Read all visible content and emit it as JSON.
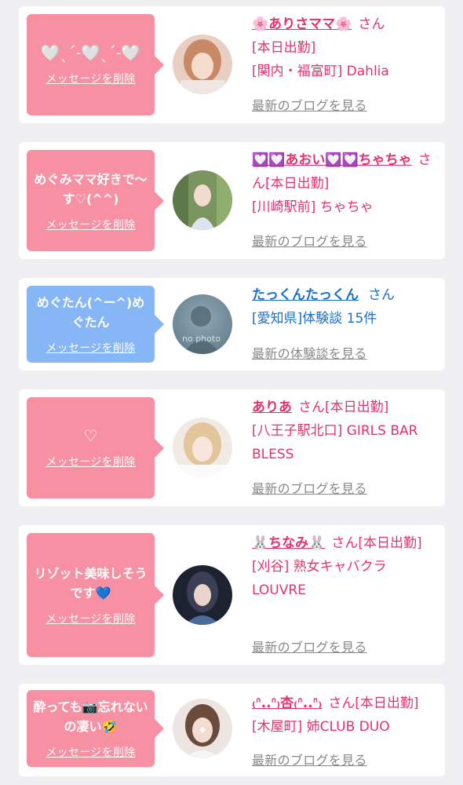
{
  "delete_label": "メッセージを削除",
  "cards": [
    {
      "message": "🤍ˎˊ˗🤍ˎˊ˗🤍",
      "name": "🌸ありさママ🌸",
      "san": "さん",
      "line2": "[本日出勤]",
      "line3": "[関内・福富町] Dahlia",
      "link": "最新のブログを見る"
    },
    {
      "message": "めぐみママ好きで〜す♡(^^)",
      "name": "💟💟あおい💟💟ちゃちゃ",
      "san": "さん[本日出勤]",
      "line2": "[川崎駅前] ちゃちゃ",
      "link": "最新のブログを見る"
    },
    {
      "message": "めぐたん(^ー^)めぐたん",
      "name": "たっくんたっくん",
      "san": "さん",
      "line2": "[愛知県]体験談 15件",
      "link": "最新の体験談を見る",
      "avatar_text": "no photo"
    },
    {
      "message": "♡",
      "name": "ありあ",
      "san": "さん[本日出勤]",
      "line2": "[八王子駅北口] GIRLS BAR BLESS",
      "link": "最新のブログを見る"
    },
    {
      "message": "リゾット美味しそうです💙",
      "name": "🐰ちなみ🐰",
      "san": "さん[本日出勤]",
      "line2": "[刈谷] 熟女キャバクラ LOUVRE",
      "link": "最新のブログを見る"
    },
    {
      "message": "酔っても📷忘れないの凄い🤣",
      "name": "₍ᐢ..ᐢ₎杏₍ᐢ..ᐢ₎",
      "san": "さん[本日出勤]",
      "line2": "[木屋町] 姉CLUB DUO",
      "link": "最新のブログを見る"
    }
  ],
  "colors": {
    "pink_bubble": "#f790a2",
    "blue_bubble": "#86b6f5",
    "name_pink": "#e8306f",
    "name_blue": "#1a6fc9",
    "link_gray": "#888888"
  }
}
